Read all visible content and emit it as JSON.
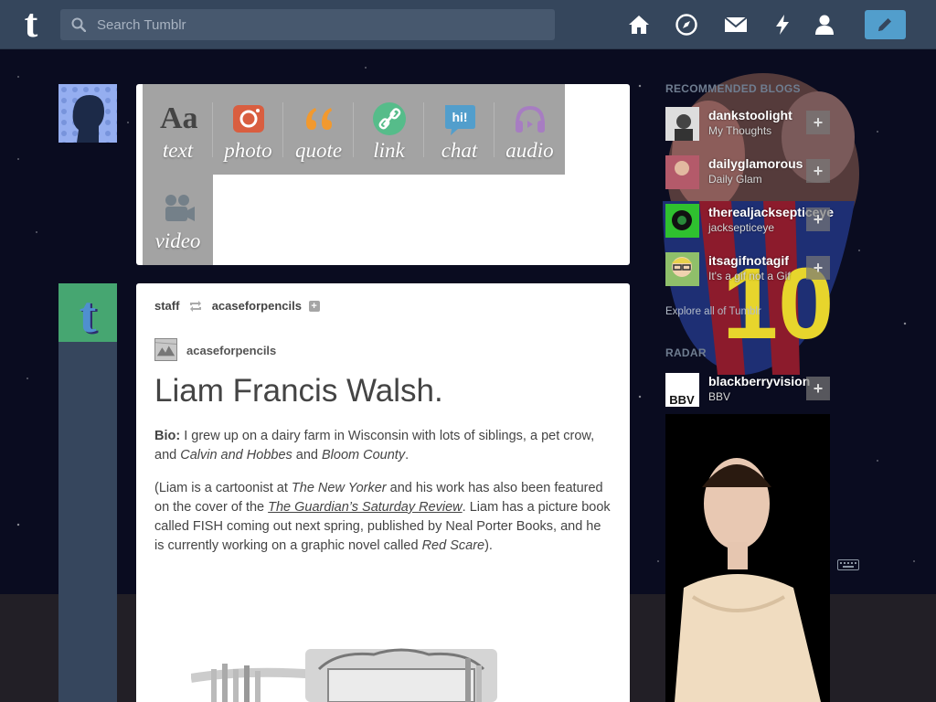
{
  "app": {
    "logo_glyph": "t"
  },
  "search": {
    "placeholder": "Search Tumblr"
  },
  "nav": {
    "icons": [
      "home-icon",
      "explore-compass-icon",
      "inbox-mail-icon",
      "activity-lightning-icon",
      "account-person-icon",
      "compose-pencil-icon"
    ]
  },
  "composer": {
    "types": [
      {
        "label": "text",
        "icon": "text-aa-icon",
        "color": "#444444"
      },
      {
        "label": "photo",
        "icon": "camera-icon",
        "color": "#d95e40"
      },
      {
        "label": "quote",
        "icon": "quote-icon",
        "color": "#f2992e"
      },
      {
        "label": "link",
        "icon": "link-icon",
        "color": "#56bc8a"
      },
      {
        "label": "chat",
        "icon": "chat-icon",
        "color": "#529ecc"
      },
      {
        "label": "audio",
        "icon": "headphones-icon",
        "color": "#a77dc2"
      },
      {
        "label": "video",
        "icon": "video-camera-icon",
        "color": "#748089"
      }
    ]
  },
  "post": {
    "reblogger": "staff",
    "reblogged_from": "acaseforpencils",
    "source_name": "acaseforpencils",
    "title": "Liam Francis Walsh.",
    "bio_label": "Bio:",
    "bio_text_1": " I grew up on a dairy farm in Wisconsin with lots of siblings, a pet crow, and ",
    "bio_em_1": "Calvin and Hobbes",
    "bio_text_2": " and ",
    "bio_em_2": "Bloom County",
    "bio_text_3": ".",
    "para2_1": "(Liam is a cartoonist at ",
    "para2_em_1": "The New Yorker",
    "para2_2": " and his work has also been featured on the cover of the ",
    "para2_link": "The Guardian’s Saturday Review",
    "para2_3": ". Liam has a picture book called FISH coming out next spring, published by Neal Porter Books, and he is currently working on a graphic novel called ",
    "para2_em_2": "Red Scare",
    "para2_4": ")."
  },
  "sidebar": {
    "recommended_title": "RECOMMENDED BLOGS",
    "blogs": [
      {
        "name": "dankstoolight",
        "subtitle": "My Thoughts"
      },
      {
        "name": "dailyglamorous",
        "subtitle": "Daily Glam"
      },
      {
        "name": "therealjacksepticeye",
        "subtitle": "jacksepticeye"
      },
      {
        "name": "itsagifnotagif",
        "subtitle": "It's a gif not a Gif"
      }
    ],
    "explore_text": "Explore all of Tumblr",
    "radar_title": "RADAR",
    "radar_blog": {
      "name": "blackberryvision",
      "subtitle": "BBV",
      "thumb_text": "BBV"
    }
  },
  "colors": {
    "topbar": "#35465c",
    "compose_button": "#529ecc",
    "staff_avatar": "#46a671"
  }
}
